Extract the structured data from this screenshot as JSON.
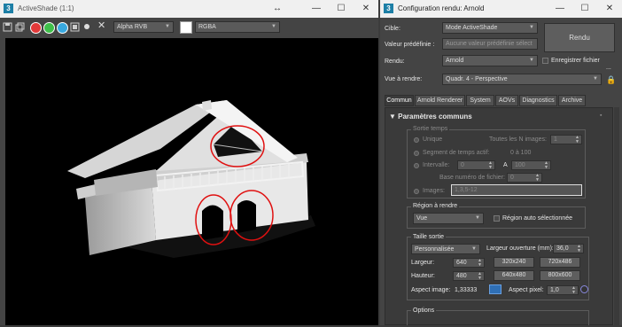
{
  "activeshade": {
    "title": "ActiveShade (1:1)",
    "channel_select": "Alpha RVB",
    "format_select": "RGBA",
    "colors": {
      "red": "#e23a3a",
      "green": "#3fbf4a",
      "blue": "#39a9e0"
    }
  },
  "config": {
    "title": "Configuration rendu: Arnold",
    "cible_label": "Cible:",
    "cible_value": "Mode ActiveShade",
    "preset_label": "Valeur prédéfinie :",
    "preset_placeholder": "Aucune valeur prédéfinie sélect",
    "rendu_label": "Rendu:",
    "rendu_value": "Arnold",
    "save_file_label": "Enregistrer fichier",
    "dots": "...",
    "view_label": "Vue à rendre:",
    "view_value": "Quadr. 4 - Perspective",
    "render_button": "Rendu",
    "tabs": [
      "Commun",
      "Arnold Renderer",
      "System",
      "AOVs",
      "Diagnostics",
      "Archive"
    ],
    "section_title": "Paramètres communs",
    "time_output": {
      "group_label": "Sortie temps",
      "unique": "Unique",
      "every_n": "Toutes les N images:",
      "every_n_value": "1",
      "active_segment": "Segment de temps actif:",
      "active_segment_range": "0 à 100",
      "interval": "Intervalle:",
      "interval_start": "0",
      "interval_a": "A",
      "interval_end": "100",
      "file_base": "Base numéro de fichier:",
      "file_base_value": "0",
      "images": "Images:",
      "images_value": "1,3,5-12"
    },
    "region": {
      "group_label": "Région à rendre",
      "value": "Vue",
      "auto_selected": "Région auto sélectionnée"
    },
    "output_size": {
      "group_label": "Taille sortie",
      "preset": "Personnalisée",
      "aperture_label": "Largeur ouverture (mm):",
      "aperture_value": "36,0",
      "width_label": "Largeur:",
      "width_value": "640",
      "height_label": "Hauteur:",
      "height_value": "480",
      "presets": [
        "320x240",
        "720x486",
        "640x480",
        "800x600"
      ],
      "image_aspect_label": "Aspect image:",
      "image_aspect_value": "1,33333",
      "pixel_aspect_label": "Aspect pixel:",
      "pixel_aspect_value": "1,0"
    },
    "options_label": "Options"
  }
}
